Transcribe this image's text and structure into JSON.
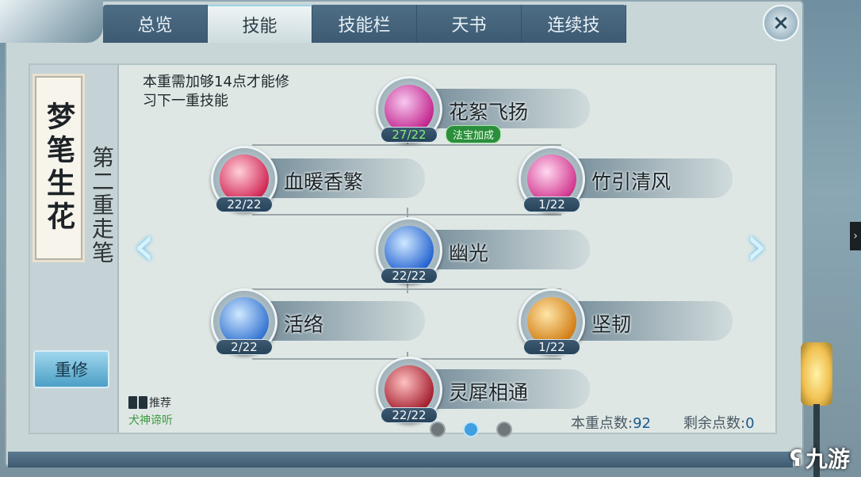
{
  "tabs": [
    {
      "label": "总览",
      "active": false
    },
    {
      "label": "技能",
      "active": true
    },
    {
      "label": "技能栏",
      "active": false
    },
    {
      "label": "天书",
      "active": false
    },
    {
      "label": "连续技",
      "active": false
    }
  ],
  "close_icon": "×",
  "sidebar": {
    "scroll_title": "梦笔生花",
    "tier_title": "第二重走笔",
    "reset_label": "重修",
    "recommend_label": "推荐",
    "recommend_value": "犬神谛听"
  },
  "requirement_text": "本重需加够14点才能修习下一重技能",
  "skills": [
    {
      "name": "花絮飞扬",
      "level": "27/22",
      "over_cap": true,
      "bonus": "法宝加成",
      "icon": "pink-petal-icon",
      "color_a": "#f7c8f0",
      "color_b": "#c0208a"
    },
    {
      "name": "血暖香繁",
      "level": "22/22",
      "over_cap": false,
      "icon": "red-swirl-icon",
      "color_a": "#ffd0d8",
      "color_b": "#d02050"
    },
    {
      "name": "竹引清风",
      "level": "1/22",
      "over_cap": false,
      "icon": "pink-wind-icon",
      "color_a": "#ffd8f0",
      "color_b": "#d0308a"
    },
    {
      "name": "幽光",
      "level": "22/22",
      "over_cap": false,
      "icon": "blue-crystal-icon",
      "color_a": "#cfe8ff",
      "color_b": "#1f5fd0"
    },
    {
      "name": "活络",
      "level": "2/22",
      "over_cap": false,
      "icon": "blue-shield-icon",
      "color_a": "#cfe8ff",
      "color_b": "#2f70d0"
    },
    {
      "name": "坚韧",
      "level": "1/22",
      "over_cap": false,
      "icon": "gold-shield-icon",
      "color_a": "#ffe6a8",
      "color_b": "#d07a10"
    },
    {
      "name": "灵犀相通",
      "level": "22/22",
      "over_cap": false,
      "icon": "fox-spirit-icon",
      "color_a": "#ffc0c0",
      "color_b": "#a01a2a"
    }
  ],
  "points": {
    "tier_label": "本重点数:",
    "tier_value": "92",
    "remaining_label": "剩余点数:",
    "remaining_value": "0"
  },
  "nav": {
    "prev": "‹",
    "next": "›"
  },
  "pagination": {
    "count": 3,
    "active": 1
  },
  "watermark": "九游"
}
